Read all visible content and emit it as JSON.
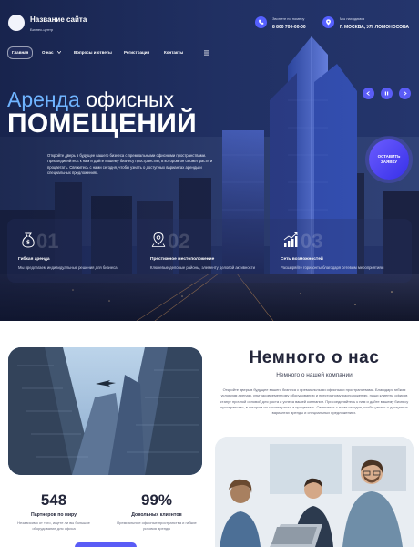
{
  "header": {
    "site_name": "Название сайта",
    "site_tagline": "Бизнес-центр",
    "phone_label": "Звоните по номеру",
    "phone": "8 800 700-00-00",
    "address_label": "Мы находимся",
    "address": "Г. МОСКВА, УЛ. ЛОМОНОСОВА"
  },
  "nav": {
    "items": [
      "Главная",
      "О нас",
      "Вопросы и ответы",
      "Регистрация",
      "Контакты"
    ],
    "active": "Главная"
  },
  "hero": {
    "title_part1": "Аренда",
    "title_part2": "офисных",
    "title_line2": "ПОМЕЩЕНИЙ",
    "text": "Откройте дверь в будущее вашего бизнеса с премиальными офисными пространствами. Присоединяйтесь к нам и дайте вашему бизнесу пространство, в котором он сможет расти и процветать. Свяжитесь с нами сегодня, чтобы узнать о доступных вариантах аренды и специальных предложениях.",
    "cta_label": "ОСТАВИТЬ ЗАЯВКУ"
  },
  "features": [
    {
      "num": "01",
      "icon": "money-bag-icon",
      "title": "Гибкая аренда",
      "desc": "Мы предлагаем индивидуальные решения для бизнеса"
    },
    {
      "num": "02",
      "icon": "map-pin-icon",
      "title": "Престижное местоположение",
      "desc": "Ключевые деловые районы, элементу деловой активности"
    },
    {
      "num": "03",
      "icon": "growth-chart-icon",
      "title": "Сеть возможностей",
      "desc": "Расширяйте горизонты благодаря сетевым мероприятиям"
    }
  ],
  "about": {
    "title": "Немного о нас",
    "subtitle": "Немного о нашей компании",
    "text": "Откройте дверь в будущее вашего бизнеса с премиальными офисными пространствами. Благодаря гибким условиям аренды, ультрасовременному оборудованию и престижному расположению, наши клиенты офисов станут прочной основой для роста и успеха вашей компании. Присоединяйтесь к нам и дайте вашему бизнесу пространство, в котором он сможет расти и процветать. Свяжитесь с нами сегодня, чтобы узнать о доступных вариантах аренды и специальных предложениях."
  },
  "stats": [
    {
      "value": "548",
      "label": "Партнеров по миру",
      "desc": "Независимо от того, ищете ли вы большое оборудование для офиса"
    },
    {
      "value": "99%",
      "label": "Довольных клиентов",
      "desc": "Премиальные офисные пространства и гибкие условия аренды"
    }
  ],
  "colors": {
    "accent": "#5a5cf6",
    "accent_light": "#6fb4ff",
    "dark_text": "#23263a"
  }
}
